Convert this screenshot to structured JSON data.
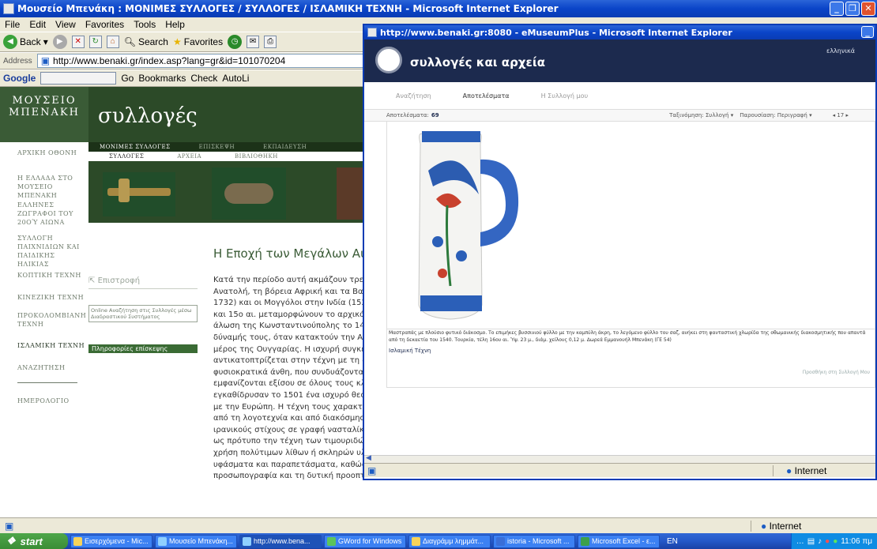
{
  "back_window": {
    "title": "Μουσείο Μπενάκη : ΜΟΝΙΜΕΣ ΣΥΛΛΟΓΕΣ / ΣΥΛΛΟΓΕΣ / ΙΣΛΑΜΙΚΗ ΤΕΧΝΗ - Microsoft Internet Explorer",
    "menu": [
      "File",
      "Edit",
      "View",
      "Favorites",
      "Tools",
      "Help"
    ],
    "toolbar": {
      "back": "Back",
      "search": "Search",
      "favorites": "Favorites"
    },
    "address_label": "Address",
    "address_value": "http://www.benaki.gr/index.asp?lang=gr&id=101070204",
    "google_bar": {
      "logo": "Google",
      "go": "Go",
      "bookmarks": "Bookmarks",
      "check": "Check",
      "autolink": "AutoLi"
    },
    "status": {
      "zone": "Internet"
    }
  },
  "benaki_site": {
    "logo_line1": "ΜΟΥΣΕΙΟ",
    "logo_line2": "ΜΠΕΝΑΚΗ",
    "section_title": "συλλογές",
    "nav": [
      "ΜΟΝΙΜΕΣ ΣΥΛΛΟΓΕΣ",
      "ΕΠΙΣΚΕΨΗ",
      "ΕΚΠΑΙΔΕΥΣΗ"
    ],
    "subnav": [
      "ΣΥΛΛΟΓΕΣ",
      "ΑΡΧΕΙΑ",
      "ΒΙΒΛΙΟΘΗΚΗ"
    ],
    "sidebar": [
      "ΑΡΧΙΚΗ ΟΘΟΝΗ",
      "Η ΕΛΛΑΔΑ ΣΤΟ ΜΟΥΣΕΙΟ ΜΠΕΝΑΚΗ",
      "ΕΛΛΗΝΕΣ ΖΩΓΡΑΦΟΙ ΤΟΥ 20ού ΑΙΩΝΑ",
      "ΣΥΛΛΟΓΗ ΠΑΙΧΝΙΔΙΩΝ ΚΑΙ ΠΑΙΔΙΚΗΣ ΗΛΙΚΙΑΣ",
      "ΚΟΠΤΙΚΗ ΤΕΧΝΗ",
      "ΚΙΝΕΖΙΚΗ ΤΕΧΝΗ",
      "ΠΡΟΚΟΛΟΜΒΙΑΝΗ ΤΕΧΝΗ",
      "ΙΣΛΑΜΙΚΗ ΤΕΧΝΗ",
      "ΑΝΑΖΗΤΗΣΗ",
      "ΗΜΕΡΟΛΟΓΙΟ"
    ],
    "back_link": "Επιστροφή",
    "online_search": "Online Αναζήτηση στις Συλλογές μέσω Διαδραστικού Συστήματος",
    "visit_info": "Πληροφορίες επίσκεψης",
    "article_title": "Η Εποχή των Μεγάλων Αυτ",
    "article_lines": [
      "Κατά την περίοδο αυτή ακμάζουν τρεις",
      "Ανατολή, τη βόρεια Αφρική και τα Βαλκά",
      "1732) και οι Μογγόλοι στην Ινδία (1526-",
      "και 15ο αι. μεταμορφώνουν το αρχικά μ",
      "άλωση της Κωνσταντινούπολης το 1453",
      "δύναμής τους, όταν κατακτούν την Αιγυ",
      "μέρος της Ουγγαρίας. Η ισχυρή συγκεντ",
      "αντικατοπτρίζεται στην τέχνη με τη δημ",
      "φυσιοκρατικά άνθη, που συνδυάζονται μ",
      "εμφανίζονται εξίσου σε όλους τους κλάδ",
      "εγκαθίδρυσαν το 1501 ένα ισχυρό θεοκρ",
      "με την Ευρώπη. Η τέχνη τους χαρακτηρ",
      "από τη λογοτεχνία και από διακόσμηση",
      "ιρανικούς στίχους σε γραφή νασταλίκ. Σ",
      "ως πρότυπο την τέχνη των τιμουριδών",
      "χρήση πολύτιμων λίθων ή σκληρών υλικ",
      "υφάσματα και παραπετάσματα, καθώς κ",
      "προσωπογραφία και τη δυτική προοπτικ"
    ]
  },
  "front_window": {
    "title": "http://www.benaki.gr:8080 - eMuseumPlus - Microsoft Internet Explorer",
    "header_title": "συλλογές και αρχεία",
    "lang_link": "ελληνικά",
    "tabs": [
      "Αναζήτηση",
      "Αποτελέσματα",
      "Η Συλλογή μου"
    ],
    "results_label": "Αποτελέσματα:",
    "results_count": "69",
    "sort": "Ταξινόμηση: Συλλογή ▾",
    "view": "Παρουσίαση: Περιγραφή ▾",
    "pager": "◂ 17 ▸",
    "description": "Μαστραπάς με πλούσιο φυτικό διάκοσμο. Το επιμήκες βυσσινιού φύλλο με την καμπύλη άκρη, το λεγόμενο φύλλο του σαζ, ανήκει στη φανταστική χλωρίδα της οθωμανικής διακοσμητικής που απαντά από τη δεκαετία του 1540. Τουρκία, τέλη 16ου αι. Ύψ. 23 μ., διάμ. χείλους 0,12 μ. Δωρεά Εμμανουήλ Μπενάκη (ΓΕ 54)",
    "collection_link": "Ισλαμική Τέχνη",
    "add_link": "Προσθήκη στη Συλλογή Μου",
    "status_zone": "Internet"
  },
  "taskbar": {
    "start": "start",
    "tasks": [
      "Εισερχόμενα - Mic...",
      "Μουσείο Μπενάκη...",
      "http://www.bena...",
      "GWord for Windows",
      "Διαγράμμ λημμάτ...",
      "istoria - Microsoft ...",
      "Microsoft Excel - ε..."
    ],
    "lang": "EN",
    "clock": "11:06 πμ"
  },
  "colors": {
    "site_green": "#2c4a28",
    "emuseum_navy": "#1c2a4e",
    "xp_blue": "#0a44c8"
  }
}
